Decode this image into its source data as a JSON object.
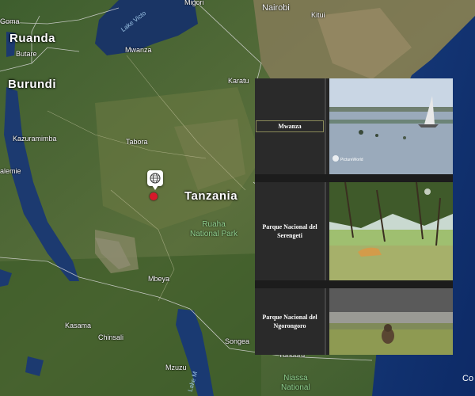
{
  "map": {
    "countries": {
      "rwanda": "Ruanda",
      "burundi": "Burundi",
      "tanzania": "Tanzania"
    },
    "cities": {
      "migori": "Migori",
      "nairobi": "Nairobi",
      "kitui": "Kitui",
      "goma": "Goma",
      "butare": "Butare",
      "mwanza": "Mwanza",
      "karatu": "Karatu",
      "kazurumimba": "Kazuramimba",
      "tabora": "Tabora",
      "kalemie": "alemie",
      "mbeya": "Mbeya",
      "kasama": "Kasama",
      "chinsali": "Chinsali",
      "songea": "Songea",
      "mzuzu": "Mzuzu",
      "tunduru": "Tunduru",
      "edge_right": "Co"
    },
    "lakes": {
      "victoria": "Lake Victo",
      "malawi": "Lake M"
    },
    "parks": {
      "ruaha": [
        "Ruaha",
        "National Park"
      ],
      "niassa": [
        "Niassa",
        "National"
      ]
    }
  },
  "marker": {
    "icon": "globe-icon",
    "dot_color": "#d7192a"
  },
  "places": [
    {
      "name": "Mwanza"
    },
    {
      "name": "Parque Nacional del Serengeti"
    },
    {
      "name": "Parque Nacional del Ngorongoro"
    }
  ],
  "thumbs": {
    "watermark": "PictureWorld"
  }
}
